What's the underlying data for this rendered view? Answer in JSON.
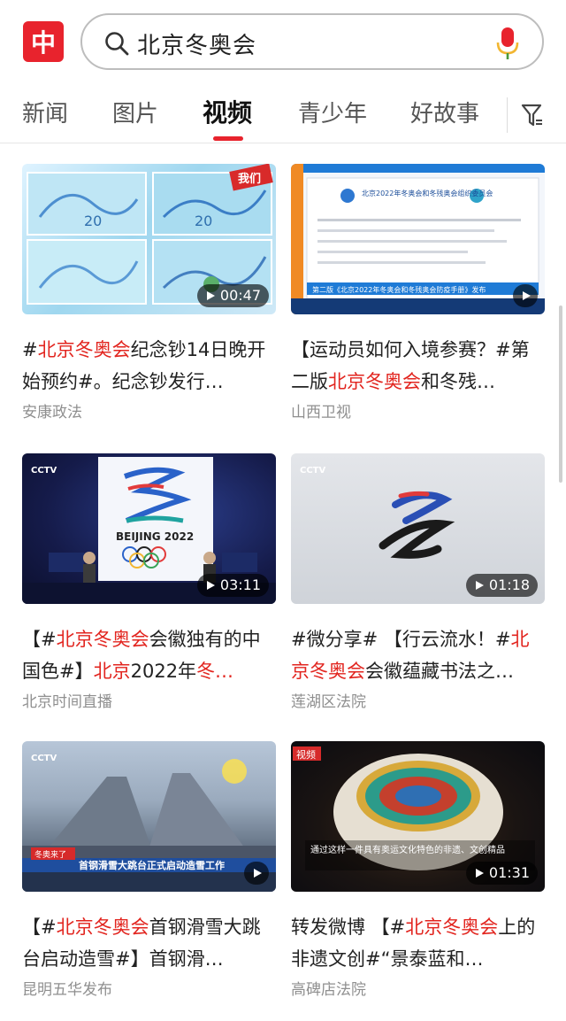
{
  "header": {
    "app_logo": "中",
    "search_query": "北京冬奥会",
    "icons": {
      "search": "search-icon",
      "mic": "mic-icon",
      "filter": "filter-icon"
    },
    "colors": {
      "brand": "#e8232d",
      "highlight": "#e2251f"
    }
  },
  "tabs": [
    {
      "label": "新闻",
      "active": false
    },
    {
      "label": "图片",
      "active": false
    },
    {
      "label": "视频",
      "active": true
    },
    {
      "label": "青少年",
      "active": false
    },
    {
      "label": "好故事",
      "active": false
    }
  ],
  "cards": [
    {
      "duration": "00:47",
      "title_parts": [
        {
          "t": "#",
          "hl": false
        },
        {
          "t": "北京冬奥会",
          "hl": true
        },
        {
          "t": "纪念钞14日晚开始预约#。纪念钞发行…",
          "hl": false
        }
      ],
      "source": "安康政法",
      "thumb_text": {
        "corner": "我们",
        "n1": "20",
        "n2": "20"
      }
    },
    {
      "duration": "",
      "title_parts": [
        {
          "t": "【运动员如何入境参赛？#第二版",
          "hl": false
        },
        {
          "t": "北京冬奥会",
          "hl": true
        },
        {
          "t": "和冬残…",
          "hl": false
        }
      ],
      "source": "山西卫视",
      "thumb_text": {
        "doc_title": "北京2022年冬奥会和冬残奥会组织委员会",
        "ticker": "第二版《北京2022年冬奥会和冬残奥会防疫手册》发布"
      }
    },
    {
      "duration": "03:11",
      "title_parts": [
        {
          "t": "【#",
          "hl": false
        },
        {
          "t": "北京冬奥会",
          "hl": true
        },
        {
          "t": "会徽独有的中国色#】",
          "hl": false
        },
        {
          "t": "北京",
          "hl": true
        },
        {
          "t": "2022年",
          "hl": false
        },
        {
          "t": "冬…",
          "hl": true
        }
      ],
      "source": "北京时间直播",
      "thumb_text": {
        "emblem": "BEIJING 2022",
        "channel": "CCTV"
      }
    },
    {
      "duration": "01:18",
      "title_parts": [
        {
          "t": "#微分享# 【行云流水！#",
          "hl": false
        },
        {
          "t": "北京冬奥会",
          "hl": true
        },
        {
          "t": "会徽蕴藏书法之…",
          "hl": false
        }
      ],
      "source": "莲湖区法院",
      "thumb_text": {
        "channel": "CCTV"
      }
    },
    {
      "duration": "",
      "title_parts": [
        {
          "t": "【#",
          "hl": false
        },
        {
          "t": "北京冬奥会",
          "hl": true
        },
        {
          "t": "首钢滑雪大跳台启动造雪#】首钢滑…",
          "hl": false
        }
      ],
      "source": "昆明五华发布",
      "thumb_text": {
        "tag": "冬奥来了",
        "ticker": "首钢滑雪大跳台正式启动造雪工作",
        "channel": "CCTV"
      }
    },
    {
      "duration": "01:31",
      "title_parts": [
        {
          "t": "转发微博 【#",
          "hl": false
        },
        {
          "t": "北京冬奥会",
          "hl": true
        },
        {
          "t": "上的非遗文创#“景泰蓝和…",
          "hl": false
        }
      ],
      "source": "高碑店法院",
      "thumb_text": {
        "tag": "视频",
        "caption": "通过这样一件具有奥运文化特色的非遗、文创精品"
      }
    }
  ]
}
